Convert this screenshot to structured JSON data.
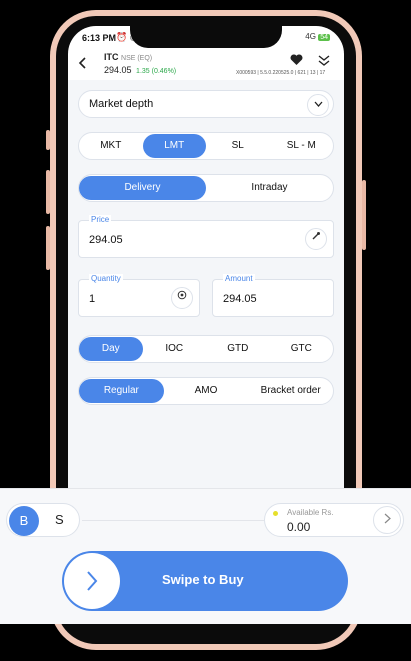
{
  "status_bar": {
    "time": "6:13 PM",
    "icons": "⏰ ◉ ◎ ·",
    "right": "4G",
    "battery": "54"
  },
  "header": {
    "symbol": "ITC",
    "exchange": "NSE (EQ)",
    "price": "294.05",
    "change": "1.35 (0.46%)",
    "ticker": "X000593 | 5.5.0.220525.0 | 621 | 13 | 17"
  },
  "market_depth": {
    "label": "Market depth"
  },
  "order_types": [
    "MKT",
    "LMT",
    "SL",
    "SL - M"
  ],
  "product_types": [
    "Delivery",
    "Intraday"
  ],
  "price_field": {
    "label": "Price",
    "value": "294.05"
  },
  "quantity_field": {
    "label": "Quantity",
    "value": "1"
  },
  "amount_field": {
    "label": "Amount",
    "value": "294.05"
  },
  "validity": [
    "Day",
    "IOC",
    "GTD",
    "GTC"
  ],
  "variety": [
    "Regular",
    "AMO",
    "Bracket order"
  ],
  "action_panel": {
    "buy_label": "B",
    "sell_label": "S",
    "available_title": "Available Rs.",
    "available_value": "0.00",
    "swipe_label": "Swipe to Buy"
  },
  "colors": {
    "accent": "#4a86e8",
    "positive": "#2ba84a",
    "phone_frame": "#f1c9b8"
  },
  "icons": {
    "back": "back-arrow-icon",
    "favorite": "heart-icon",
    "collapse": "double-chevron-icon",
    "dropdown": "chevron-down-icon",
    "picker": "eyedropper-icon",
    "quantity_helper": "qty-helper-icon",
    "next": "chevron-right-icon"
  }
}
